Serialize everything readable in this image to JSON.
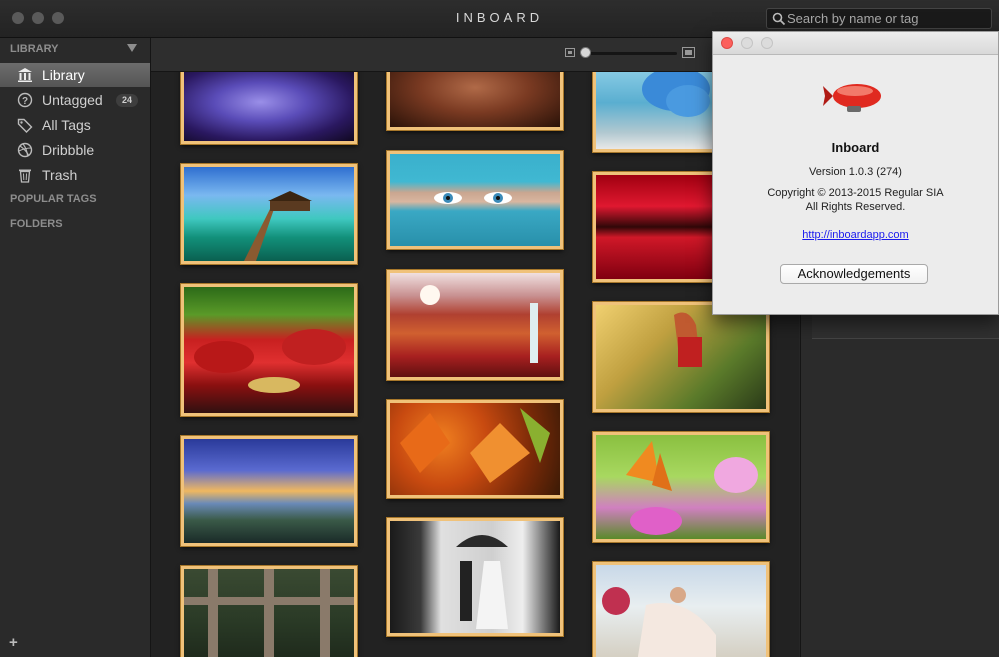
{
  "window": {
    "title": "INBOARD",
    "search_placeholder": "Search by name or tag"
  },
  "sidebar": {
    "library_header": "LIBRARY",
    "items": [
      {
        "label": "Library",
        "icon": "library-icon",
        "selected": true
      },
      {
        "label": "Untagged",
        "icon": "question-icon",
        "badge": "24"
      },
      {
        "label": "All Tags",
        "icon": "tag-icon"
      },
      {
        "label": "Dribbble",
        "icon": "dribbble-icon"
      },
      {
        "label": "Trash",
        "icon": "trash-icon"
      }
    ],
    "popular_tags_header": "POPULAR TAGS",
    "folders_header": "FOLDERS",
    "add_label": "+"
  },
  "toolbar": {
    "zoom_level": 0
  },
  "about": {
    "app_name": "Inboard",
    "version": "Version 1.0.3 (274)",
    "copyright": "Copyright © 2013-2015 Regular SIA",
    "rights": "All Rights Reserved.",
    "link": "http://inboardapp.com",
    "ack_button": "Acknowledgements"
  },
  "thumbnails": [
    {
      "name": "rose-image",
      "subject": "purple rose"
    },
    {
      "name": "tropical-pier-image",
      "subject": "pier over turquoise water"
    },
    {
      "name": "red-garden-image",
      "subject": "red flowering garden"
    },
    {
      "name": "sunset-lake-image",
      "subject": "lake at sunset"
    },
    {
      "name": "window-frame-image",
      "subject": "old window frame"
    },
    {
      "name": "tattoo-image",
      "subject": "tattooed arm"
    },
    {
      "name": "blue-scarf-eyes-image",
      "subject": "woman in blue scarf"
    },
    {
      "name": "autumn-waterfall-image",
      "subject": "autumn waterfall"
    },
    {
      "name": "autumn-leaves-image",
      "subject": "autumn leaves"
    },
    {
      "name": "wedding-umbrella-image",
      "subject": "black and white wedding"
    },
    {
      "name": "blue-butterfly-image",
      "subject": "blue butterfly"
    },
    {
      "name": "red-lake-image",
      "subject": "red lake"
    },
    {
      "name": "girl-road-image",
      "subject": "girl on road"
    },
    {
      "name": "butterfly-flower-image",
      "subject": "butterfly on pink flower"
    },
    {
      "name": "wedding-couple-image",
      "subject": "wedding couple"
    }
  ],
  "colors": {
    "thumb_border": "#f0c27a",
    "close_red": "#fc605c"
  }
}
